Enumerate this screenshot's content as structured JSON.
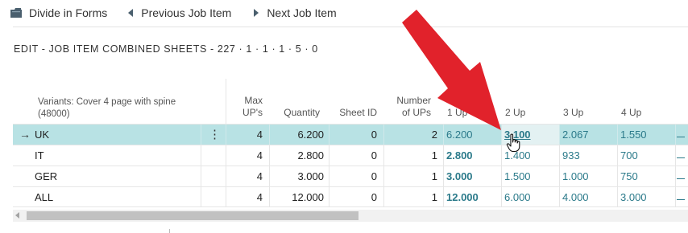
{
  "toolbar": {
    "divide_label": "Divide in Forms",
    "prev_label": "Previous Job Item",
    "next_label": "Next Job Item"
  },
  "page_title": "EDIT - JOB ITEM COMBINED SHEETS - 227 · 1 · 1 · 1 · 5 · 0",
  "grid": {
    "variant_header_line1": "Variants: Cover 4 page with spine",
    "variant_header_line2": "(48000)",
    "headers": {
      "max_ups_1": "Max",
      "max_ups_2": "UP's",
      "quantity": "Quantity",
      "sheet_id": "Sheet ID",
      "number_ups_1": "Number",
      "number_ups_2": "of UPs",
      "up1": "1 Up",
      "up2": "2 Up",
      "up3": "3 Up",
      "up4": "4 Up"
    },
    "rows": [
      {
        "variant": "UK",
        "max_ups": "4",
        "quantity": "6.200",
        "sheet_id": "0",
        "number_ups": "2",
        "up1": "6.200",
        "up2": "3.100",
        "up3": "2.067",
        "up4": "1.550"
      },
      {
        "variant": "IT",
        "max_ups": "4",
        "quantity": "2.800",
        "sheet_id": "0",
        "number_ups": "1",
        "up1": "2.800",
        "up2": "1.400",
        "up3": "933",
        "up4": "700"
      },
      {
        "variant": "GER",
        "max_ups": "4",
        "quantity": "3.000",
        "sheet_id": "0",
        "number_ups": "1",
        "up1": "3.000",
        "up2": "1.500",
        "up3": "1.000",
        "up4": "750"
      },
      {
        "variant": "ALL",
        "max_ups": "4",
        "quantity": "12.000",
        "sheet_id": "0",
        "number_ups": "1",
        "up1": "12.000",
        "up2": "6.000",
        "up3": "4.000",
        "up4": "3.000"
      }
    ]
  },
  "colors": {
    "selected_row": "#b8e2e4",
    "link": "#2b7a8a",
    "annotation_arrow": "#e1222b"
  },
  "icons": {
    "divide": "folder-icon",
    "prev": "triangle-left-icon",
    "next": "triangle-right-icon",
    "row_marker": "arrow-right-icon",
    "row_menu": "vertical-dots-icon",
    "pointer": "hand-cursor-icon"
  }
}
